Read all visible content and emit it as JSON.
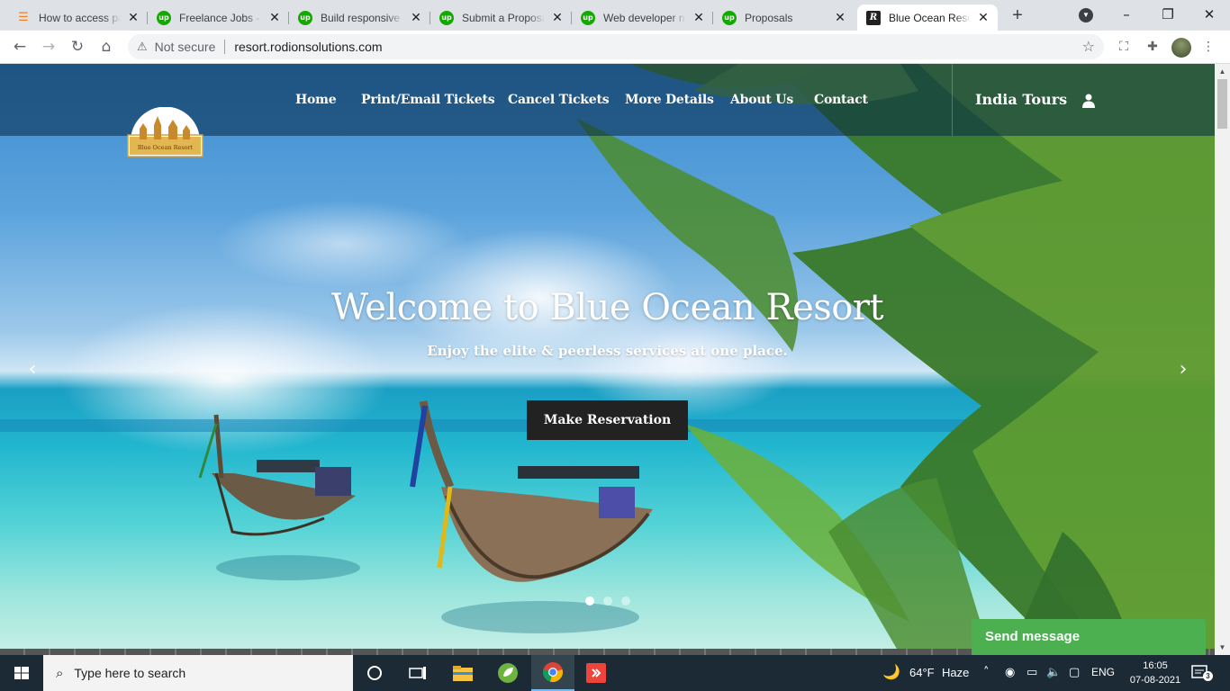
{
  "browser": {
    "tabs": [
      {
        "title": "How to access pa",
        "favicon": "stackoverflow-icon"
      },
      {
        "title": "Freelance Jobs - U",
        "favicon": "upwork-icon"
      },
      {
        "title": "Build responsive w",
        "favicon": "upwork-icon"
      },
      {
        "title": "Submit a Proposal",
        "favicon": "upwork-icon"
      },
      {
        "title": "Web developer ne",
        "favicon": "upwork-icon"
      },
      {
        "title": "Proposals",
        "favicon": "upwork-icon"
      },
      {
        "title": "Blue Ocean Resor",
        "favicon": "resort-r-icon",
        "active": true
      }
    ],
    "security_label": "Not secure",
    "url": "resort.rodionsolutions.com"
  },
  "site": {
    "nav": {
      "items": [
        "Home",
        "Print/Email Tickets",
        "Cancel Tickets",
        "More Details",
        "About Us",
        "Contact"
      ],
      "brand": "India Tours"
    },
    "logo_text": "Blue Ocean Resort",
    "hero": {
      "title": "Welcome to Blue Ocean Resort",
      "subtitle": "Enjoy the elite & peerless services at one place.",
      "cta_label": "Make Reservation",
      "slides_total": 3,
      "slide_active": 1
    },
    "chat": {
      "label": "Send message"
    }
  },
  "taskbar": {
    "search_placeholder": "Type here to search",
    "weather": {
      "temp": "64°F",
      "condition": "Haze"
    },
    "language": "ENG",
    "time": "16:05",
    "date": "07-08-2021",
    "notifications": "3"
  },
  "colors": {
    "accent_green": "#4caf50",
    "cta_bg": "#222222",
    "upwork_green": "#14a800"
  }
}
